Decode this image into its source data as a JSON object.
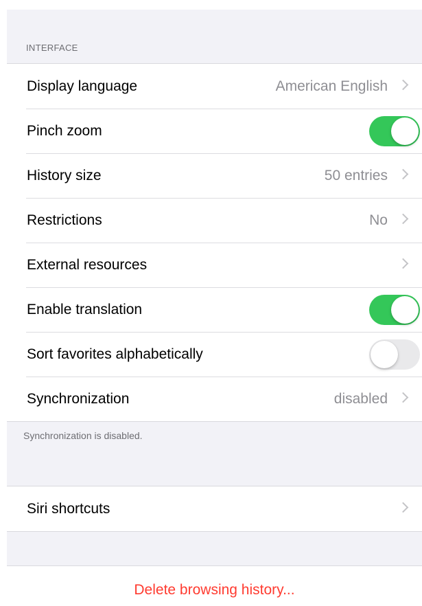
{
  "sections": {
    "interface": {
      "header": "INTERFACE",
      "rows": [
        {
          "label": "Display language",
          "value": "American English",
          "chevron": true
        },
        {
          "label": "Pinch zoom",
          "toggle": "on"
        },
        {
          "label": "History size",
          "value": "50 entries",
          "chevron": true
        },
        {
          "label": "Restrictions",
          "value": "No",
          "chevron": true
        },
        {
          "label": "External resources",
          "value": "",
          "chevron": true
        },
        {
          "label": "Enable translation",
          "toggle": "on"
        },
        {
          "label": "Sort favorites alphabetically",
          "toggle": "off"
        },
        {
          "label": "Synchronization",
          "value": "disabled",
          "chevron": true
        }
      ],
      "footer": "Synchronization is disabled."
    },
    "siri": {
      "rows": [
        {
          "label": "Siri shortcuts",
          "chevron": true
        }
      ]
    },
    "danger": {
      "delete_label": "Delete browsing history..."
    }
  },
  "colors": {
    "toggle_on": "#34c759",
    "destructive": "#ff3b30",
    "secondary_text": "#8e8e93",
    "grouped_background": "#f2f2f7"
  }
}
